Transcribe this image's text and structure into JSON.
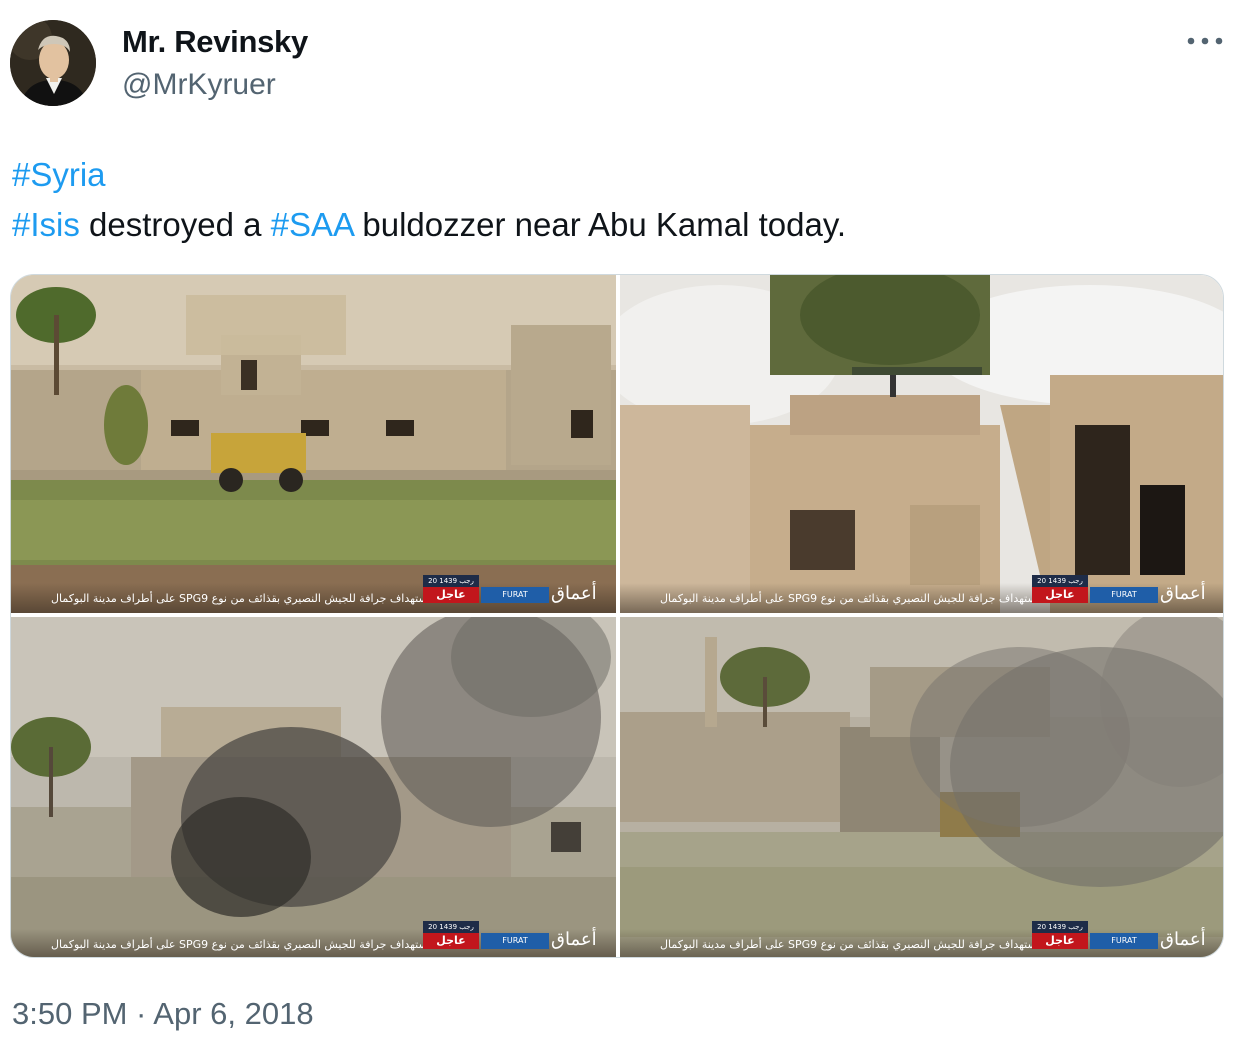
{
  "author": {
    "display_name": "Mr. Revinsky",
    "handle": "@MrKyruer",
    "avatar_icon": "portrait-avatar"
  },
  "tweet": {
    "line1": {
      "hashtag": "#Syria"
    },
    "line2": {
      "hashtag1": "#Isis",
      "text1": " destroyed a ",
      "hashtag2": "#SAA",
      "text2": " buldozzer near Abu Kamal today."
    },
    "hashtag_color": "#1d9bf0"
  },
  "media": [
    {
      "ticker_text": "استهداف جرافة للجيش النصيري بقذائف من نوع SPG9 على أطراف مدينة البوكمال",
      "date_label": "20 رجب 1439",
      "urgent_label": "عاجل",
      "agency_label": "FURAT",
      "logo_text": "أعماق"
    },
    {
      "ticker_text": "استهداف جرافة للجيش النصيري بقذائف من نوع SPG9 على أطراف مدينة البوكمال",
      "date_label": "20 رجب 1439",
      "urgent_label": "عاجل",
      "agency_label": "FURAT",
      "logo_text": "أعماق"
    },
    {
      "ticker_text": "استهداف جرافة للجيش النصيري بقذائف من نوع SPG9 على أطراف مدينة البوكمال",
      "date_label": "20 رجب 1439",
      "urgent_label": "عاجل",
      "agency_label": "FURAT",
      "logo_text": "أعماق"
    },
    {
      "ticker_text": "استهداف جرافة للجيش النصيري بقذائف من نوع SPG9 على أطراف مدينة البوكمال",
      "date_label": "20 رجب 1439",
      "urgent_label": "عاجل",
      "agency_label": "FURAT",
      "logo_text": "أعماق"
    }
  ],
  "timestamp": "3:50 PM · Apr 6, 2018",
  "icons": {
    "more": "more-horizontal-icon"
  }
}
